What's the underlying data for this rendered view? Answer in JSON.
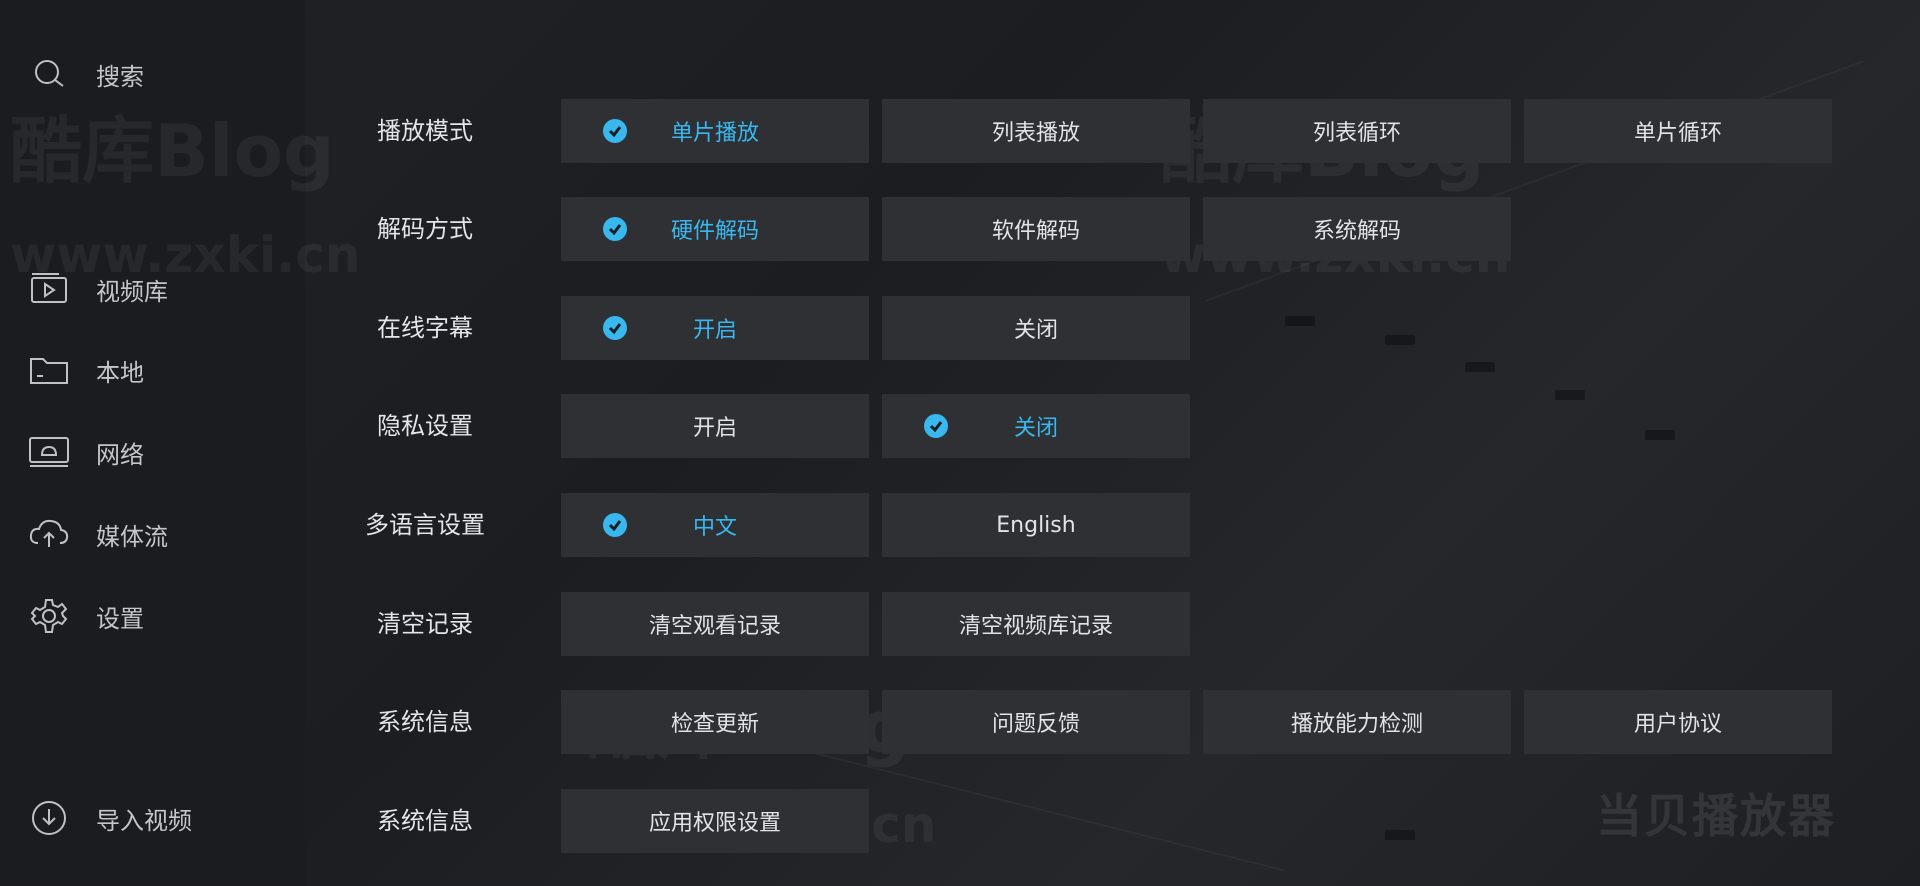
{
  "sidebar": {
    "search": "搜索",
    "items": [
      {
        "label": "视频库",
        "icon": "video-library-icon"
      },
      {
        "label": "本地",
        "icon": "folder-icon"
      },
      {
        "label": "网络",
        "icon": "network-icon"
      },
      {
        "label": "媒体流",
        "icon": "cloud-icon"
      },
      {
        "label": "设置",
        "icon": "gear-icon"
      }
    ],
    "import": "导入视频"
  },
  "settings": [
    {
      "label": "播放模式",
      "options": [
        "单片播放",
        "列表播放",
        "列表循环",
        "单片循环"
      ],
      "selected": 0
    },
    {
      "label": "解码方式",
      "options": [
        "硬件解码",
        "软件解码",
        "系统解码"
      ],
      "selected": 0
    },
    {
      "label": "在线字幕",
      "options": [
        "开启",
        "关闭"
      ],
      "selected": 0
    },
    {
      "label": "隐私设置",
      "options": [
        "开启",
        "关闭"
      ],
      "selected": 1
    },
    {
      "label": "多语言设置",
      "options": [
        "中文",
        "English"
      ],
      "selected": 0
    },
    {
      "label": "清空记录",
      "options": [
        "清空观看记录",
        "清空视频库记录"
      ],
      "selected": null
    },
    {
      "label": "系统信息",
      "options": [
        "检查更新",
        "问题反馈",
        "播放能力检测",
        "用户协议"
      ],
      "selected": null
    },
    {
      "label": "系统信息",
      "options": [
        "应用权限设置"
      ],
      "selected": null
    }
  ],
  "watermark": {
    "cn": "酷库",
    "blog": "Blog",
    "url": "www.zxki.cn"
  },
  "brand": "当贝播放器",
  "colors": {
    "accent": "#39b8ef",
    "button_bg": "#2e3034",
    "sidebar_bg": "#1a1c20"
  }
}
